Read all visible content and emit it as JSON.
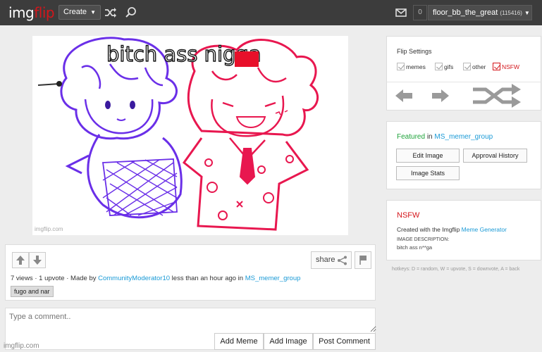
{
  "nav": {
    "logo_a": "img",
    "logo_b": "flip",
    "create_label": "Create",
    "shuffle_icon": "shuffle-icon",
    "search_icon": "search-icon",
    "mail_icon": "mail-icon",
    "notification_count": "0",
    "username": "floor_bb_the_great",
    "user_points": "(115416)"
  },
  "meme": {
    "caption": "bitch ass nigga",
    "watermark": "imgflip.com",
    "censor_color": "#e8102a"
  },
  "actions": {
    "share_label": "share",
    "views": "7 views",
    "upvotes": "1 upvote",
    "made_by_prefix": "Made by",
    "author": "CommunityModerator10",
    "time_text": "less than an hour ago in",
    "stream": "MS_memer_group",
    "tag": "fugo and nar",
    "separator": "·"
  },
  "comment": {
    "placeholder": "Type a comment..",
    "add_meme": "Add Meme",
    "add_image": "Add Image",
    "post_comment": "Post Comment"
  },
  "footer": {
    "brand": "imgflip.com"
  },
  "flip_settings": {
    "title": "Flip Settings",
    "options": [
      "memes",
      "gifs",
      "other",
      "NSFW"
    ]
  },
  "featured": {
    "featured_word": "Featured",
    "in_word": "in",
    "stream": "MS_memer_group",
    "edit_image": "Edit Image",
    "approval_history": "Approval History",
    "image_stats": "Image Stats"
  },
  "info": {
    "nsfw_label": "NSFW",
    "created_prefix": "Created with the Imgflip",
    "generator_link": "Meme Generator",
    "desc_label": "IMAGE DESCRIPTION:",
    "desc_text": "bitch ass n**ga"
  },
  "hotkeys": "hotkeys: D = random, W = upvote, S = downvote, A = back",
  "colors": {
    "brand_red": "#d4161b",
    "link_blue": "#1a9ad6",
    "featured_green": "#1ea33a",
    "nav_bg": "#3c3c3c"
  }
}
